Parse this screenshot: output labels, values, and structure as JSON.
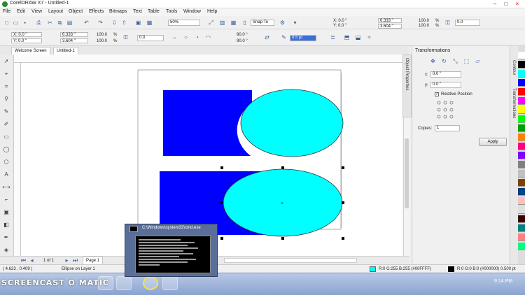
{
  "window": {
    "title": "CorelDRAW X7 - Untitled-1",
    "minimize": "–",
    "maximize": "□",
    "close": "×"
  },
  "menu": [
    "File",
    "Edit",
    "View",
    "Layout",
    "Object",
    "Effects",
    "Bitmaps",
    "Text",
    "Table",
    "Tools",
    "Window",
    "Help"
  ],
  "toolbar1": {
    "zoom": "50%",
    "snap_to": "Snap To",
    "x": "X: 0.0 \"",
    "y": "Y: 0.0 \"",
    "w": "6.333 \"",
    "h": "3.604 \"",
    "scale_w": "100.0",
    "scale_h": "100.0",
    "pct": "%",
    "rotation": "0.0"
  },
  "toolbar2": {
    "x": "X: 0.0 \"",
    "y": "Y: 0.0 \"",
    "w": "6.333 \"",
    "h": "3.604 \"",
    "scale_w": "100.0",
    "scale_h": "100.0",
    "pct": "%",
    "rotation": "0.0",
    "angle1": "90.0 °",
    "angle2": "90.0 °",
    "outline": "0.5 pt"
  },
  "tabs": [
    "Welcome Screen",
    "Untitled-1"
  ],
  "docker": {
    "title": "Transformations",
    "x_label": "x:",
    "x_value": "0.0 \"",
    "y_label": "y:",
    "y_value": "0.0 \"",
    "relative_position": "Relative Position",
    "copies_label": "Copies:",
    "copies_value": "1",
    "apply": "Apply"
  },
  "side_tabs": {
    "object_properties": "Object Properties",
    "contour": "Contour",
    "transformations": "Transformations"
  },
  "page_nav": {
    "page_count": "1 of 1",
    "page_tab": "Page 1"
  },
  "status": {
    "coords": "( 4.623 , 0.409 )",
    "info": "Ellipse on Layer 1",
    "fill": "R:0 G:255 B:255 (#00FFFF)",
    "outline": "R:0 G:0 B:0 (#000000)  0.500 pt"
  },
  "cmd_window": {
    "title": "C:\\Windows\\system32\\cmd.exe"
  },
  "watermark": "SCREENCAST O MATIC",
  "clock": "9:14 PM",
  "colors": {
    "blue": "#0000ff",
    "cyan": "#00ffff",
    "palette": [
      "#ffffff",
      "#000000",
      "#00ffff",
      "#0000ff",
      "#ff0000",
      "#ff00ff",
      "#ffff00",
      "#00ff00",
      "#00a000",
      "#ff8000",
      "#ff0080",
      "#8000ff",
      "#808080",
      "#c0c0c0",
      "#804000",
      "#004080",
      "#ffc0c0",
      "#e0e0e0",
      "#400000",
      "#008080",
      "#ff8080",
      "#00ff80"
    ]
  }
}
